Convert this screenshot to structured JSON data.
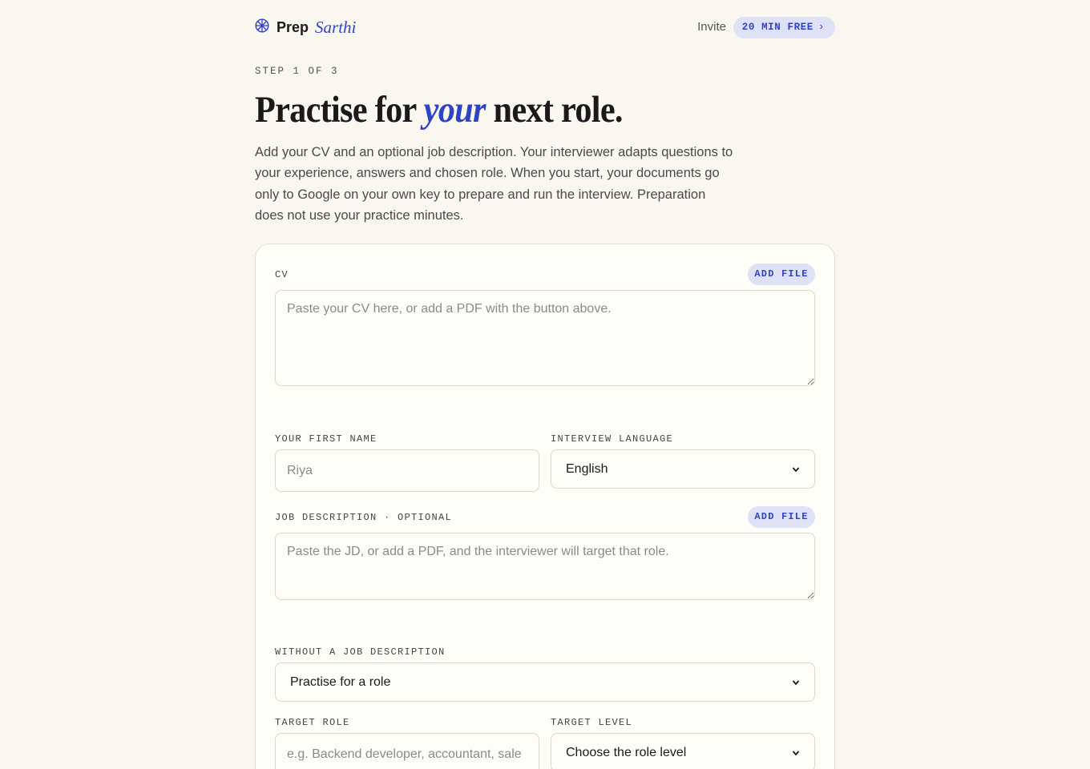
{
  "brand": {
    "name_bold": "Prep",
    "name_italic": "Sarthi",
    "icon": "compass-wheel-icon"
  },
  "nav": {
    "invite": "Invite",
    "free_pill": "20 MIN FREE",
    "free_pill_chevron": "›"
  },
  "step": "STEP 1 OF 3",
  "headline": {
    "before": "Practise for",
    "accent": "your",
    "after": "next role."
  },
  "intro": "Add your CV and an optional job description. Your interviewer adapts questions to your experience, answers and chosen role. When you start, your documents go only to Google on your own key to prepare and run the interview. Preparation does not use your practice minutes.",
  "form": {
    "cv": {
      "label": "CV",
      "add_file": "ADD FILE",
      "placeholder": "Paste your CV here, or add a PDF with the button above."
    },
    "first_name": {
      "label": "YOUR FIRST NAME",
      "placeholder": "Riya"
    },
    "language": {
      "label": "INTERVIEW LANGUAGE",
      "selected": "English"
    },
    "jd": {
      "label": "JOB DESCRIPTION · OPTIONAL",
      "add_file": "ADD FILE",
      "placeholder": "Paste the JD, or add a PDF, and the interviewer will target that role."
    },
    "without_jd": {
      "label": "WITHOUT A JOB DESCRIPTION",
      "selected": "Practise for a role"
    },
    "target_role": {
      "label": "TARGET ROLE",
      "placeholder": "e.g. Backend developer, accountant, sale"
    },
    "target_level": {
      "label": "TARGET LEVEL",
      "selected": "Choose the role level"
    }
  },
  "colors": {
    "accent": "#2e44c7",
    "background": "#faf6f0",
    "pill": "#dfe2f7"
  }
}
